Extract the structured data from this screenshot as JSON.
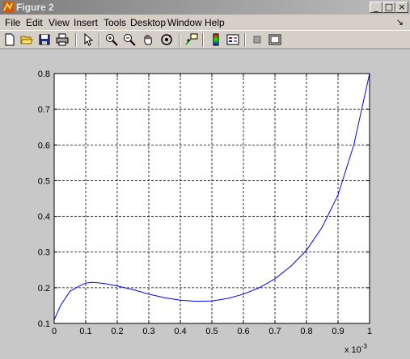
{
  "window": {
    "title": "Figure 2"
  },
  "menu": [
    "File",
    "Edit",
    "View",
    "Insert",
    "Tools",
    "Desktop",
    "Window",
    "Help"
  ],
  "menu_dock_icon": "dock-arrow-icon",
  "toolbar_icons": [
    "new-figure-icon",
    "open-file-icon",
    "save-icon",
    "print-icon",
    "edit-plot-arrow-icon",
    "zoom-in-icon",
    "zoom-out-icon",
    "pan-hand-icon",
    "rotate-3d-icon",
    "data-cursor-icon",
    "colorbar-icon",
    "legend-icon",
    "hide-plot-tools-icon",
    "show-plot-tools-icon"
  ],
  "chart_data": {
    "type": "line",
    "title": "",
    "xlabel": "",
    "ylabel": "",
    "xlim": [
      0,
      1
    ],
    "ylim": [
      0.1,
      0.8
    ],
    "x_ticks": [
      "0",
      "0.1",
      "0.2",
      "0.3",
      "0.4",
      "0.5",
      "0.6",
      "0.7",
      "0.8",
      "0.9",
      "1"
    ],
    "y_ticks": [
      "0.1",
      "0.2",
      "0.3",
      "0.4",
      "0.5",
      "0.6",
      "0.7",
      "0.8"
    ],
    "x_multiplier_base": "x 10",
    "x_multiplier_exp": "-3",
    "grid": true,
    "line_color": "#0000ff",
    "series": [
      {
        "x": [
          0,
          0.02,
          0.05,
          0.08,
          0.1,
          0.12,
          0.14,
          0.17,
          0.2,
          0.25,
          0.3,
          0.35,
          0.4,
          0.45,
          0.5,
          0.55,
          0.6,
          0.65,
          0.7,
          0.75,
          0.8,
          0.85,
          0.9,
          0.95,
          1.0
        ],
        "y": [
          0.11,
          0.15,
          0.19,
          0.205,
          0.213,
          0.215,
          0.214,
          0.21,
          0.205,
          0.195,
          0.182,
          0.172,
          0.165,
          0.162,
          0.163,
          0.17,
          0.182,
          0.2,
          0.225,
          0.26,
          0.305,
          0.37,
          0.46,
          0.6,
          0.8
        ]
      }
    ]
  }
}
